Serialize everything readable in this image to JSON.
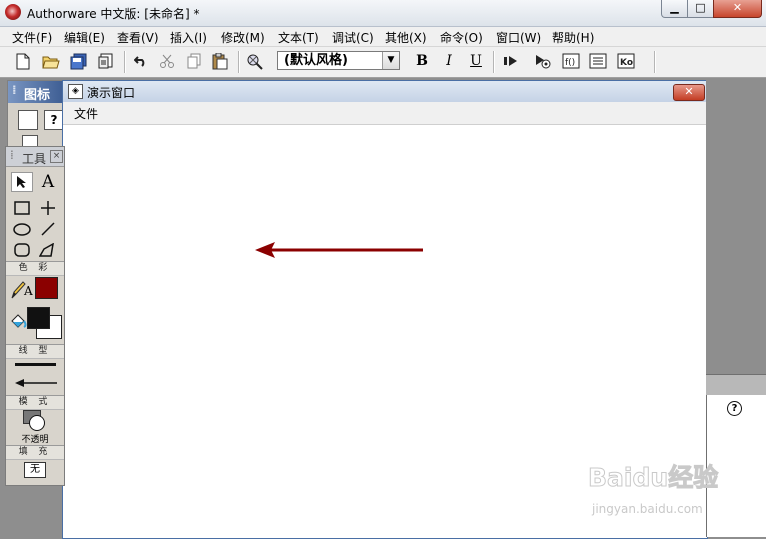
{
  "window": {
    "title": "Authorware 中文版: [未命名] *",
    "controls": {
      "minimize": "▁",
      "maximize": "□",
      "close": "✕"
    }
  },
  "menu": [
    "文件(F)",
    "编辑(E)",
    "查看(V)",
    "插入(I)",
    "修改(M)",
    "文本(T)",
    "调试(C)",
    "其他(X)",
    "命令(O)",
    "窗口(W)",
    "帮助(H)"
  ],
  "toolbar": {
    "style_value": "(默认风格)",
    "bold": "B",
    "italic": "I",
    "underline": "U",
    "icons": [
      "new-icon",
      "open-icon",
      "save-all-icon",
      "import-icon",
      "undo-icon",
      "cut-icon",
      "copy-icon",
      "paste-icon",
      "find-icon",
      "bold-icon",
      "italic-icon",
      "underline-icon",
      "restart-icon",
      "control-panel-icon",
      "functions-icon",
      "variables-icon",
      "knowledge-objects-icon"
    ]
  },
  "icon_palette": {
    "title": "图标"
  },
  "tools": {
    "title": "工具",
    "sections": {
      "color": "色 彩",
      "line": "线 型",
      "mode": "模 式",
      "fill": "填 充"
    },
    "mode_value": "不透明",
    "fill_value": "无",
    "colors": {
      "pen": "#8b0000",
      "foreground": "#111111",
      "background": "#ffffff"
    }
  },
  "presentation_window": {
    "title": "演示窗口",
    "menu_file": "文件"
  },
  "canvas": {
    "arrow_color": "#8b0000"
  },
  "watermark": {
    "brand": "Baidu经验",
    "url": "jingyan.baidu.com"
  }
}
